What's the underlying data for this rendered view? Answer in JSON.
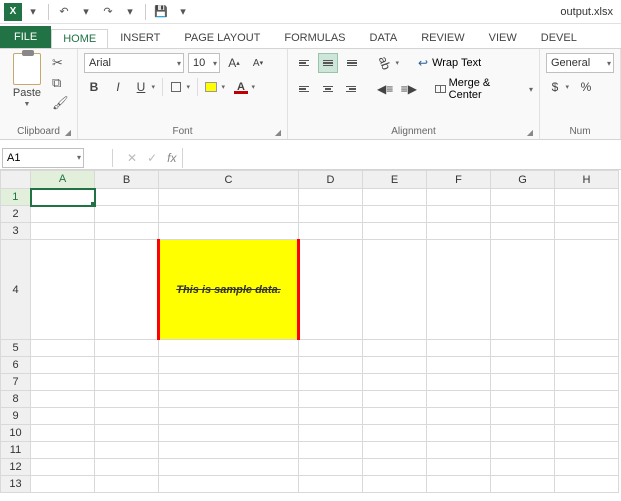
{
  "qat": {
    "filename": "output.xlsx",
    "undo_tip": "Undo",
    "redo_tip": "Redo",
    "save_tip": "Save"
  },
  "tabs": {
    "file": "FILE",
    "home": "HOME",
    "insert": "INSERT",
    "page_layout": "PAGE LAYOUT",
    "formulas": "FORMULAS",
    "data": "DATA",
    "review": "REVIEW",
    "view": "VIEW",
    "developer": "DEVEL"
  },
  "ribbon": {
    "clipboard": {
      "label": "Clipboard",
      "paste": "Paste"
    },
    "font": {
      "label": "Font",
      "name": "Arial",
      "size": "10",
      "bold": "B",
      "italic": "I",
      "underline": "U",
      "grow": "A",
      "shrink": "A"
    },
    "alignment": {
      "label": "Alignment",
      "wrap": "Wrap Text",
      "merge": "Merge & Center"
    },
    "number": {
      "label": "Num",
      "format": "General",
      "currency": "$",
      "percent": "%"
    }
  },
  "formula_bar": {
    "name_box": "A1",
    "fx": "fx",
    "cancel": "✕",
    "enter": "✓",
    "value": ""
  },
  "grid": {
    "cols": [
      "A",
      "B",
      "C",
      "D",
      "E",
      "F",
      "G",
      "H"
    ],
    "rows": [
      "1",
      "2",
      "3",
      "4",
      "5",
      "6",
      "7",
      "8",
      "9",
      "10",
      "11",
      "12",
      "13"
    ],
    "active_cell": "A1",
    "sample_text": "This is sample data."
  }
}
